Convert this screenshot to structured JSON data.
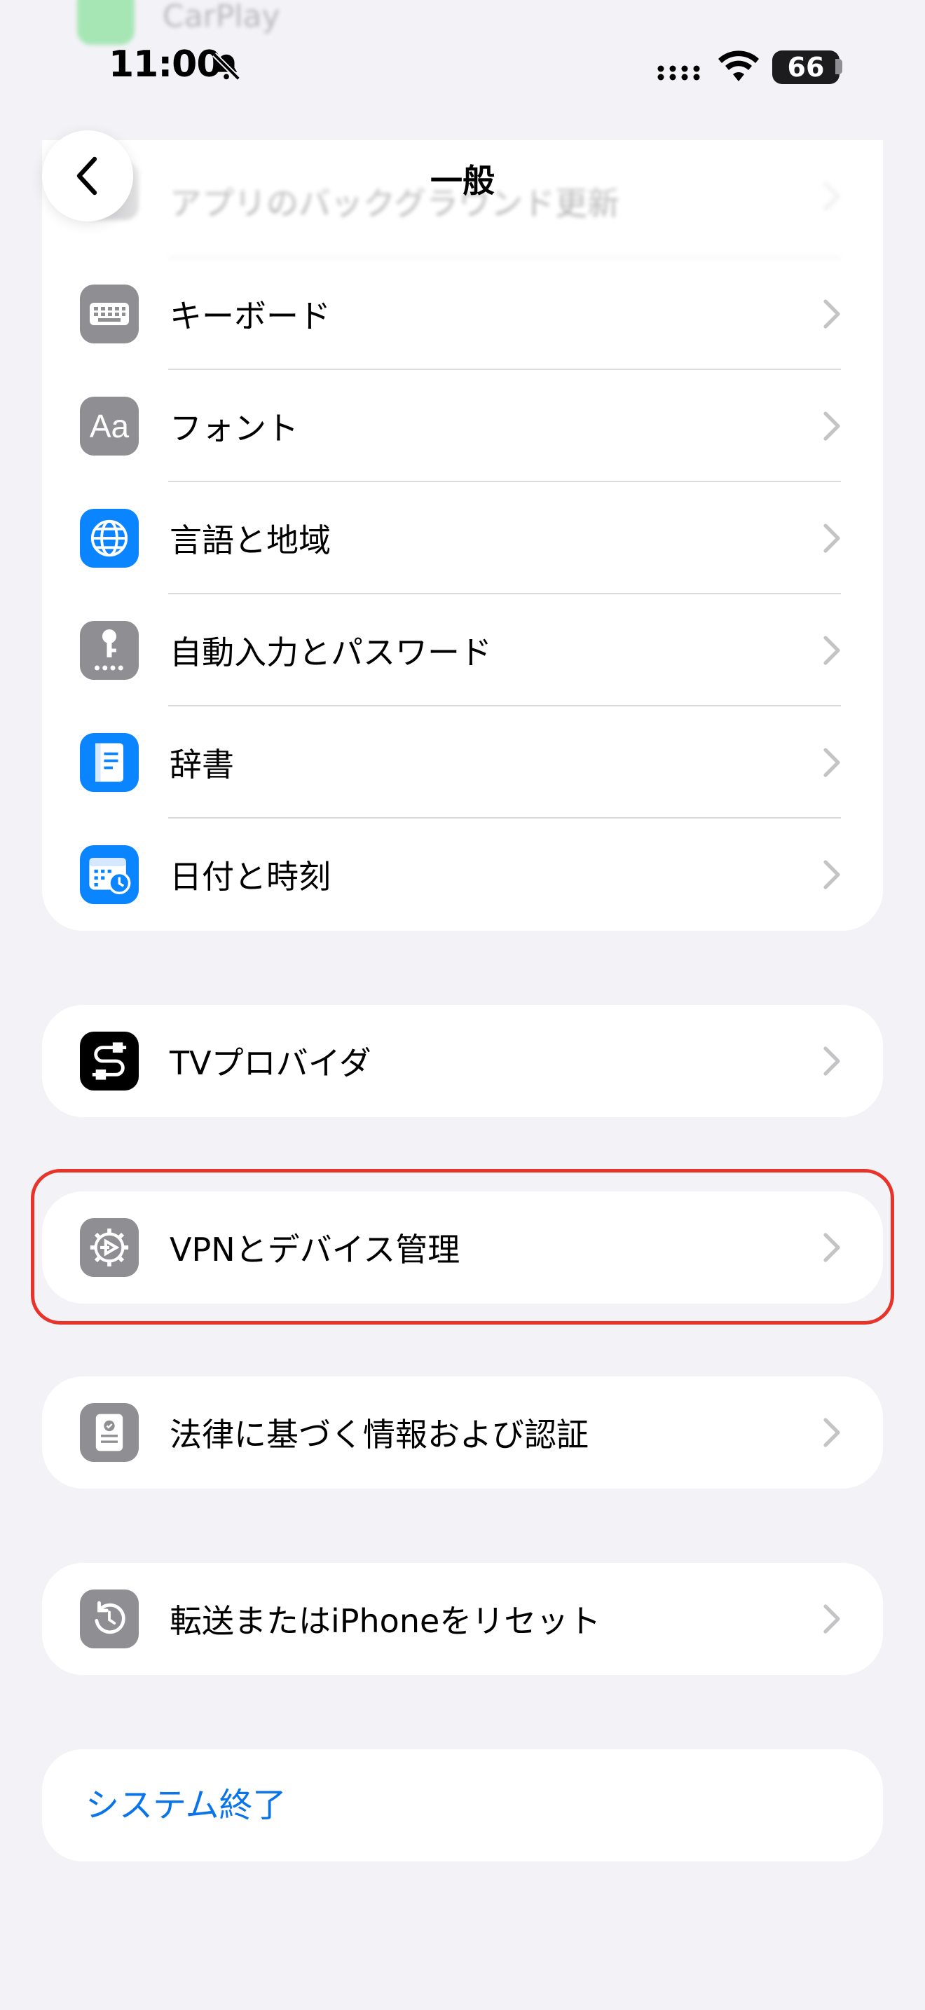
{
  "status_bar": {
    "time": "11:00",
    "battery": "66",
    "top_ghost_label": "CarPlay"
  },
  "header": {
    "title": "一般"
  },
  "group1": {
    "items": [
      {
        "label": "アプリのバックグラウンド更新",
        "icon": "app-refresh-icon"
      },
      {
        "label": "キーボード",
        "icon": "keyboard-icon",
        "color": "#8e8e93"
      },
      {
        "label": "フォント",
        "icon": "font-icon",
        "color": "#8e8e93"
      },
      {
        "label": "言語と地域",
        "icon": "globe-icon",
        "color": "#0a84ff"
      },
      {
        "label": "自動入力とパスワード",
        "icon": "key-icon",
        "color": "#8e8e93"
      },
      {
        "label": "辞書",
        "icon": "book-icon",
        "color": "#0a84ff"
      },
      {
        "label": "日付と時刻",
        "icon": "calendar-clock-icon",
        "color": "#0a84ff"
      }
    ]
  },
  "tv_provider": {
    "label": "TVプロバイダ",
    "icon": "tv-provider-icon",
    "color": "#000000"
  },
  "vpn": {
    "label": "VPNとデバイス管理",
    "icon": "gear-icon",
    "color": "#8e8e93",
    "highlight_color": "#e8332a"
  },
  "legal": {
    "label": "法律に基づく情報および認証",
    "icon": "certificate-icon",
    "color": "#8e8e93"
  },
  "reset": {
    "label": "転送またはiPhoneをリセット",
    "icon": "reset-icon",
    "color": "#8e8e93"
  },
  "shutdown": {
    "label": "システム終了",
    "color": "#0a74ea"
  },
  "font_icon_text": "Aa"
}
